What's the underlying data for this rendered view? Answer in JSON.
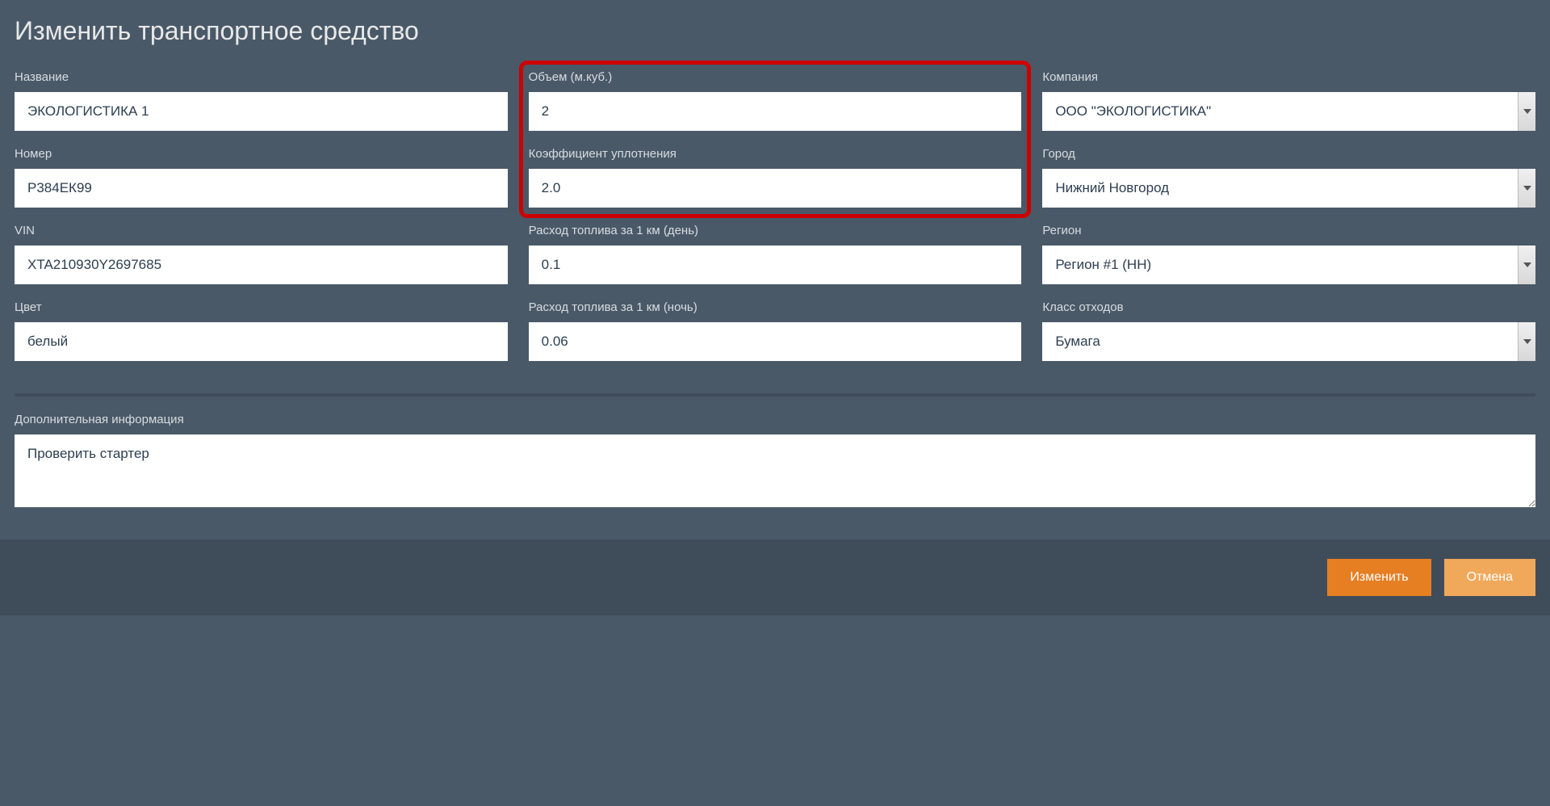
{
  "header": {
    "title": "Изменить транспортное средство"
  },
  "form": {
    "col1": {
      "name": {
        "label": "Название",
        "value": "ЭКОЛОГИСТИКА 1"
      },
      "number": {
        "label": "Номер",
        "value": "Р384ЕК99"
      },
      "vin": {
        "label": "VIN",
        "value": "XTA210930Y2697685"
      },
      "color": {
        "label": "Цвет",
        "value": "белый"
      }
    },
    "col2": {
      "volume": {
        "label": "Объем (м.куб.)",
        "value": "2"
      },
      "compaction": {
        "label": "Коэффициент уплотнения",
        "value": "2.0"
      },
      "fuel_day": {
        "label": "Расход топлива за 1 км (день)",
        "value": "0.1"
      },
      "fuel_night": {
        "label": "Расход топлива за 1 км (ночь)",
        "value": "0.06"
      }
    },
    "col3": {
      "company": {
        "label": "Компания",
        "value": "ООО \"ЭКОЛОГИСТИКА\""
      },
      "city": {
        "label": "Город",
        "value": "Нижний Новгород"
      },
      "region": {
        "label": "Регион",
        "value": "Регион #1 (НН)"
      },
      "waste_class": {
        "label": "Класс отходов",
        "value": "Бумага"
      }
    }
  },
  "additional": {
    "label": "Дополнительная информация",
    "value": "Проверить стартер"
  },
  "footer": {
    "submit": "Изменить",
    "cancel": "Отмена"
  }
}
